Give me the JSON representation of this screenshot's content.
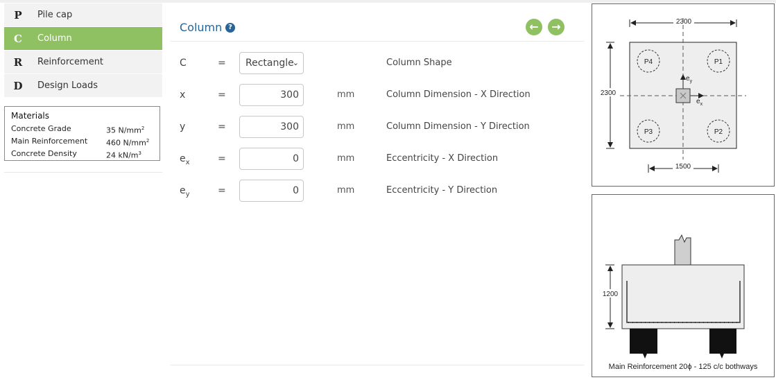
{
  "sidebar": {
    "items": [
      {
        "letter": "P",
        "label": "Pile cap"
      },
      {
        "letter": "C",
        "label": "Column"
      },
      {
        "letter": "R",
        "label": "Reinforcement"
      },
      {
        "letter": "D",
        "label": "Design Loads"
      }
    ],
    "active_index": 1
  },
  "materials": {
    "title": "Materials",
    "rows": [
      {
        "label": "Concrete Grade",
        "value": "35 N/mm",
        "sup": "2"
      },
      {
        "label": "Main Reinforcement",
        "value": "460 N/mm",
        "sup": "2"
      },
      {
        "label": "Concrete Density",
        "value": "24 kN/m",
        "sup": "3"
      }
    ]
  },
  "main": {
    "title": "Column",
    "help_icon": "?",
    "prev_icon": "arrow-left",
    "next_icon": "arrow-right",
    "params": [
      {
        "symbol": "C",
        "sub": "",
        "eq": "=",
        "value": "Rectangle",
        "type": "select",
        "unit": "",
        "description": "Column Shape"
      },
      {
        "symbol": "x",
        "sub": "",
        "eq": "=",
        "value": "300",
        "type": "input",
        "unit": "mm",
        "description": "Column Dimension - X Direction"
      },
      {
        "symbol": "y",
        "sub": "",
        "eq": "=",
        "value": "300",
        "type": "input",
        "unit": "mm",
        "description": "Column Dimension - Y Direction"
      },
      {
        "symbol": "e",
        "sub": "x",
        "eq": "=",
        "value": "0",
        "type": "input",
        "unit": "mm",
        "description": "Eccentricity - X Direction"
      },
      {
        "symbol": "e",
        "sub": "y",
        "eq": "=",
        "value": "0",
        "type": "input",
        "unit": "mm",
        "description": "Eccentricity - Y Direction"
      }
    ]
  },
  "plan_diagram": {
    "width_dim": "2300",
    "height_dim": "2300",
    "pile_spacing_dim": "1500",
    "piles": [
      "P4",
      "P1",
      "P3",
      "P2"
    ],
    "axis_x": "e",
    "axis_x_sub": "x",
    "axis_y": "e",
    "axis_y_sub": "y"
  },
  "section_diagram": {
    "depth_dim": "1200",
    "caption": "Main Reinforcement 20ϕ - 125 c/c bothways"
  },
  "colors": {
    "accent_green": "#8fc062",
    "title_blue": "#2a6496"
  }
}
